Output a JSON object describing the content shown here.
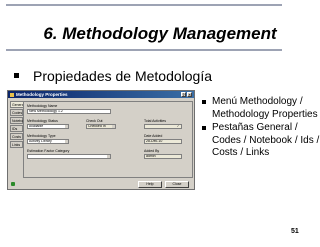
{
  "slide": {
    "title": "6. Methodology Management",
    "main_bullet": "Propiedades de Metodología",
    "right_bullets": [
      "Menú Methodology / Methodology Properties",
      "Pestañas General / Codes / Notebook / Ids / Costs / Links"
    ],
    "page_number": "51"
  },
  "window": {
    "title": "Methodology Properties",
    "title_buttons": [
      "?",
      "×"
    ],
    "tabs": [
      "General",
      "Codes",
      "Notebook",
      "IDs",
      "Costs",
      "Links"
    ],
    "fields": {
      "methodology_name_label": "Methodology Name",
      "methodology_name_value": "New Methodology 1.2",
      "status_label": "Methodology Status",
      "status_value": "Available",
      "checkout_label": "Check Out",
      "checkout_value": "Checked In",
      "total_activities_label": "Total Activities",
      "total_activities_value": "7",
      "type_label": "Methodology Type",
      "type_value": "Activity Library",
      "date_added_label": "Date Added",
      "date_added_value": "28-Dec-10",
      "estimation_label": "Estimation Factor Category",
      "added_by_label": "Added By",
      "added_by_value": "admin"
    },
    "buttons": {
      "help": "Help",
      "close": "Close"
    }
  }
}
